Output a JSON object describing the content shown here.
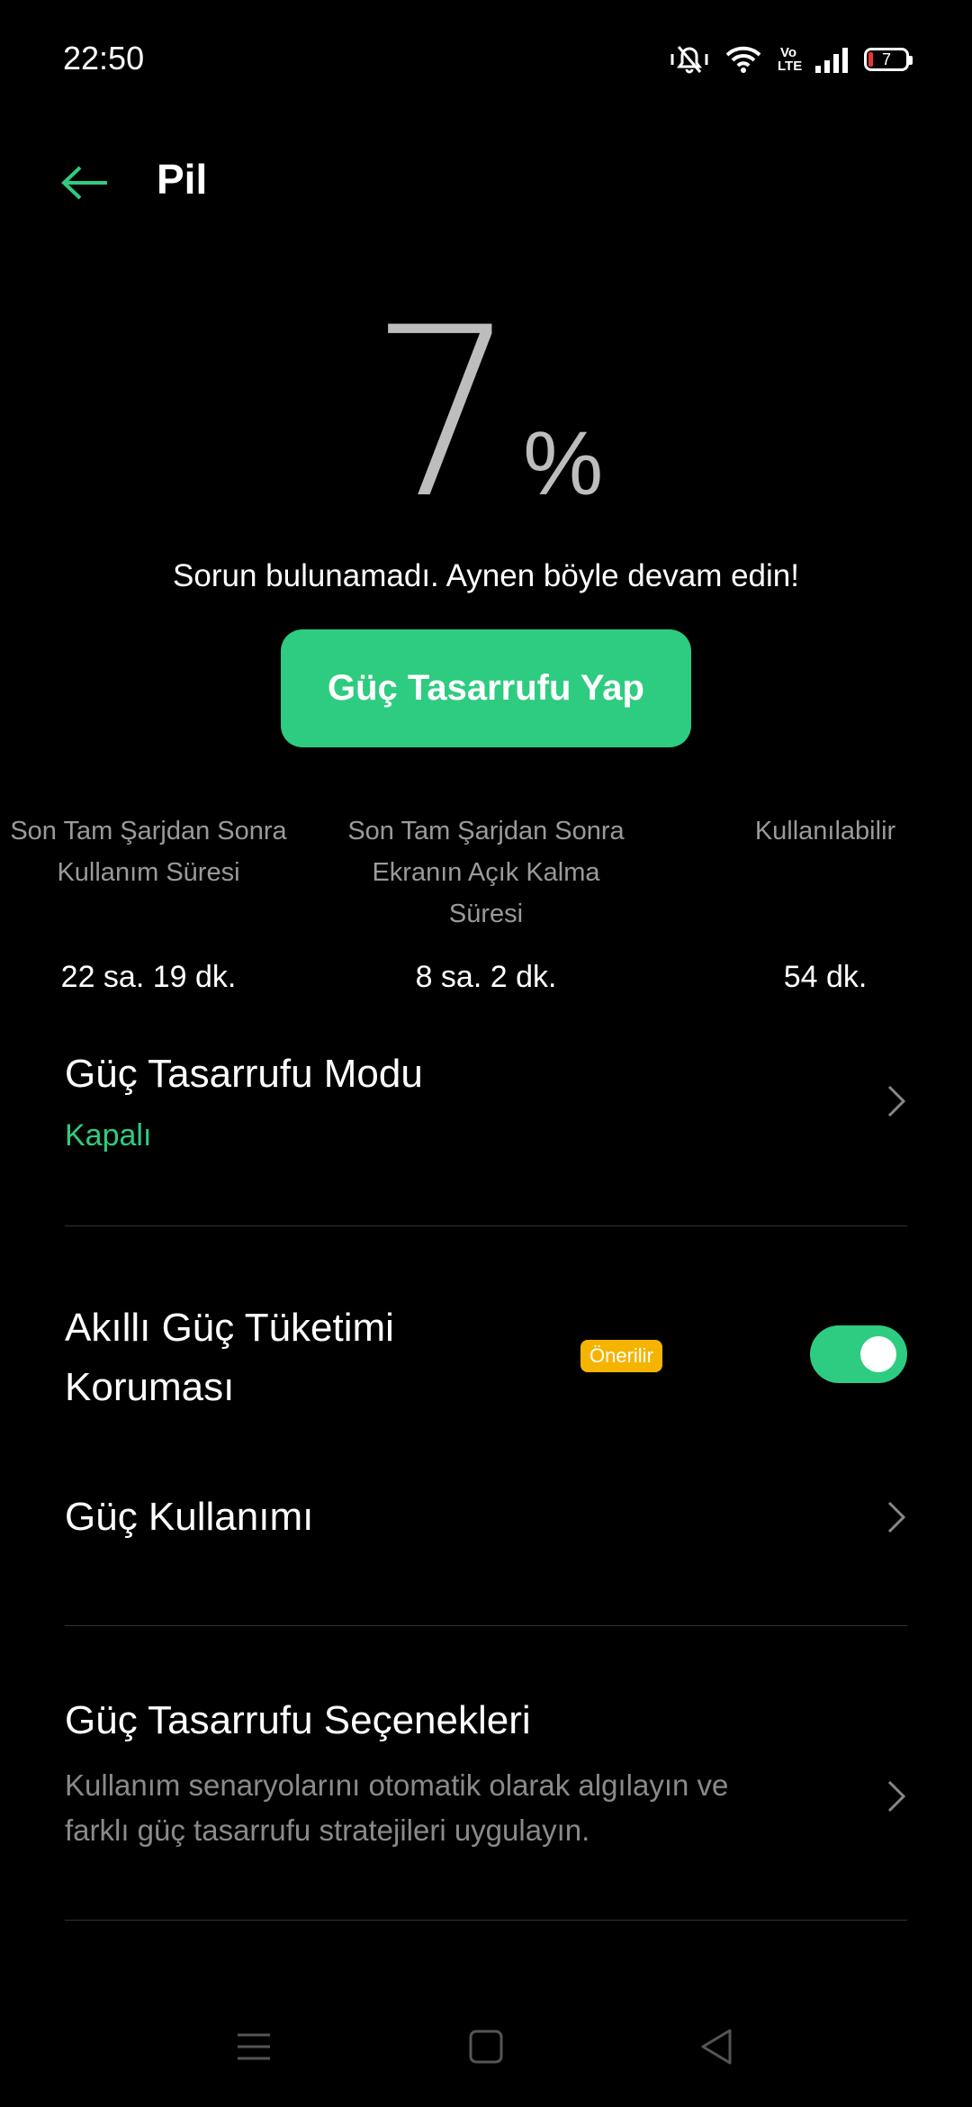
{
  "status_bar": {
    "time": "22:50",
    "battery_level": "7",
    "icons": [
      "mute-vibrate-icon",
      "wifi-icon",
      "volte-icon",
      "signal-icon",
      "battery-icon"
    ],
    "volte_text": "Vo LTE"
  },
  "header": {
    "title": "Pil",
    "back_icon": "arrow-left-icon"
  },
  "battery": {
    "percent": "7",
    "percent_sign": "%",
    "message": "Sorun bulunamadı. Aynen böyle devam edin!",
    "save_button_label": "Güç Tasarrufu Yap"
  },
  "stats": [
    {
      "label_lines": [
        "Son Tam Şarjdan Sonra",
        "Kullanım Süresi"
      ],
      "value": "22 sa. 19 dk."
    },
    {
      "label_lines": [
        "Son Tam Şarjdan Sonra",
        "Ekranın Açık Kalma",
        "Süresi"
      ],
      "value": "8 sa. 2 dk."
    },
    {
      "label_lines": [
        "Kullanılabilir"
      ],
      "value": "54 dk."
    }
  ],
  "settings": {
    "power_saving_mode": {
      "title": "Güç Tasarrufu Modu",
      "status": "Kapalı"
    },
    "smart_protection": {
      "title_lines": [
        "Akıllı Güç Tüketimi",
        "Koruması"
      ],
      "badge": "Önerilir",
      "enabled": true
    },
    "power_usage": {
      "title": "Güç Kullanımı"
    },
    "power_saving_options": {
      "title": "Güç Tasarrufu Seçenekleri",
      "desc_lines": [
        "Kullanım senaryolarını otomatik olarak algılayın ve",
        "farklı güç tasarrufu stratejileri uygulayın."
      ]
    }
  },
  "colors": {
    "accent": "#2ecc80",
    "badge": "#f5b400",
    "battery_low": "#e53935"
  }
}
